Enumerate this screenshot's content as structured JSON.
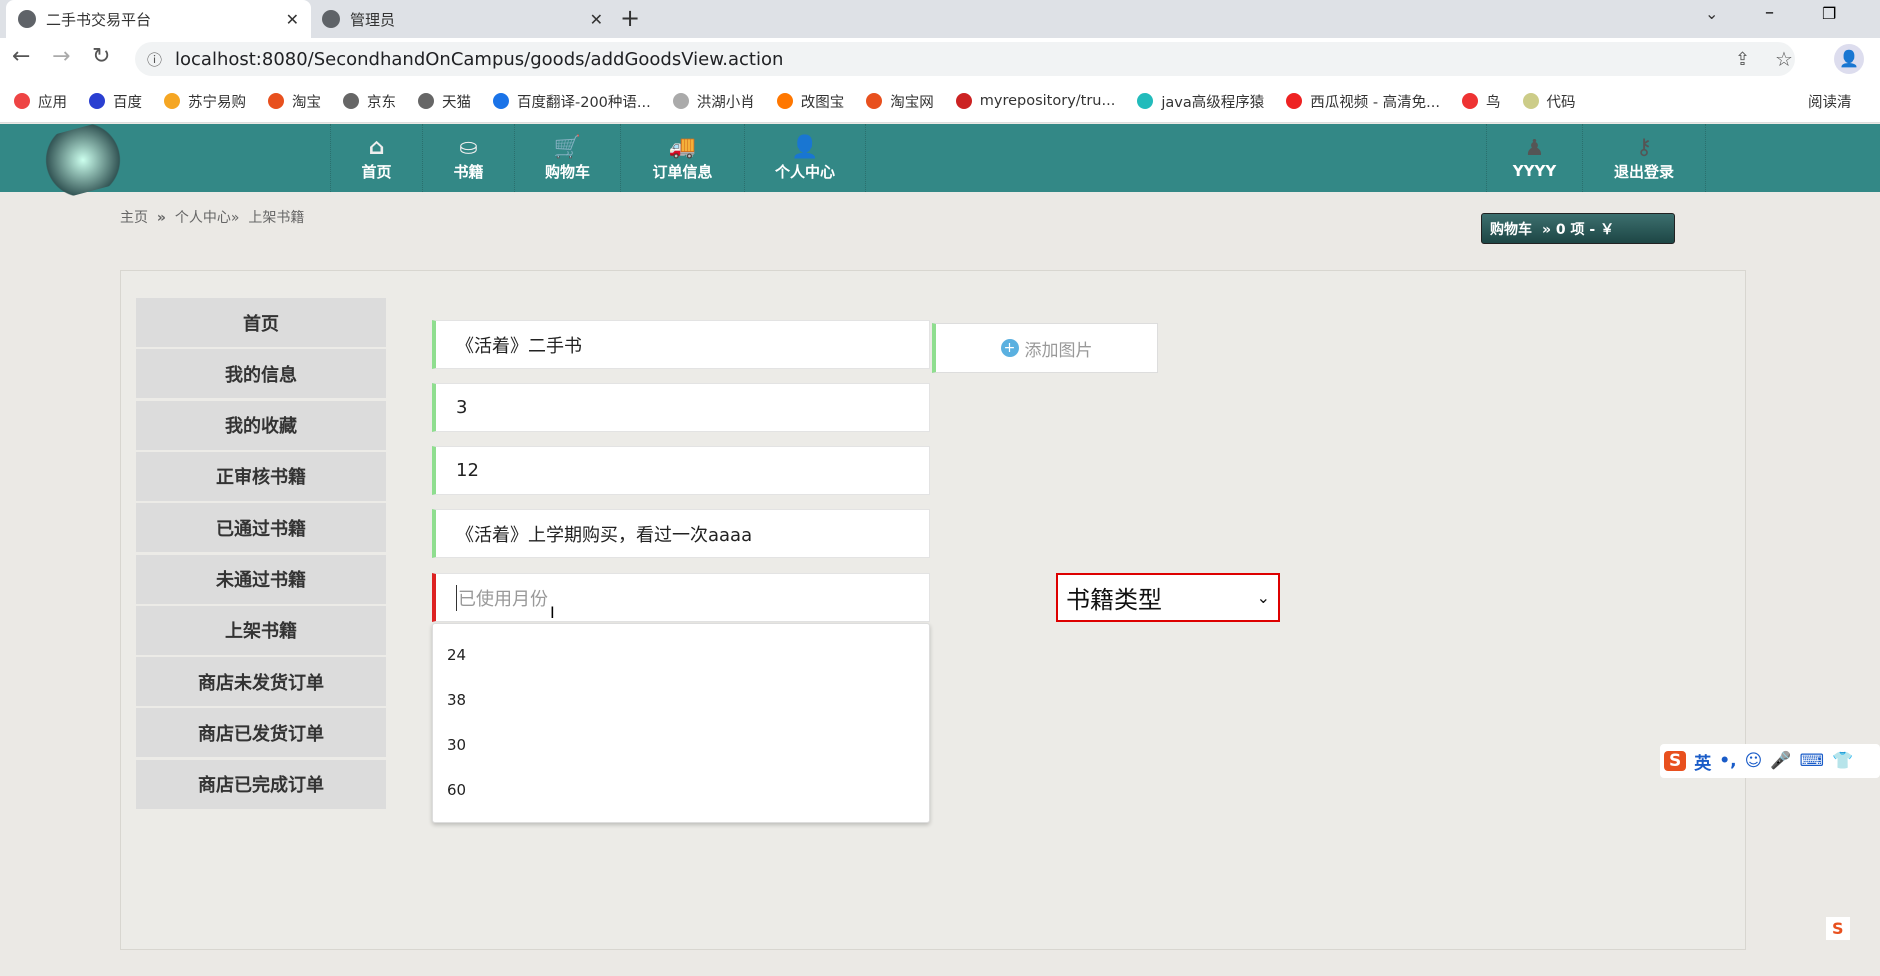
{
  "browser": {
    "tabs": [
      {
        "title": "二手书交易平台",
        "active": true
      },
      {
        "title": "管理员",
        "active": false
      }
    ],
    "url": "localhost:8080/SecondhandOnCampus/goods/addGoodsView.action",
    "bookmarks": [
      "应用",
      "百度",
      "苏宁易购",
      "淘宝",
      "京东",
      "天猫",
      "百度翻译-200种语...",
      "洪湖小肖",
      "改图宝",
      "淘宝网",
      "myrepository/tru...",
      "java高级程序猿",
      "西瓜视频 - 高清免...",
      "鸟",
      "代码"
    ],
    "reading_list": "阅读清"
  },
  "nav": {
    "items": [
      {
        "label": "首页",
        "icon": "home-icon"
      },
      {
        "label": "书籍",
        "icon": "basket-icon"
      },
      {
        "label": "购物车",
        "icon": "cart-icon"
      },
      {
        "label": "订单信息",
        "icon": "truck-icon"
      },
      {
        "label": "个人中心",
        "icon": "user-add-icon"
      }
    ],
    "user": "YYYY",
    "logout": "退出登录"
  },
  "breadcrumb": {
    "home": "主页",
    "sep": "»",
    "personal": "个人中心»",
    "current": "上架书籍"
  },
  "cart": {
    "label": "购物车",
    "summary": "» 0 项 - ￥"
  },
  "sidebar": [
    "首页",
    "我的信息",
    "我的收藏",
    "正审核书籍",
    "已通过书籍",
    "未通过书籍",
    "上架书籍",
    "商店未发货订单",
    "商店已发货订单",
    "商店已完成订单"
  ],
  "form": {
    "title": "《活着》二手书",
    "quantity": "3",
    "price": "12",
    "description": "《活着》上学期购买，看过一次aaaa",
    "months_placeholder": "已使用月份",
    "add_image": "添加图片",
    "category": "书籍类型",
    "suggestions": [
      "24",
      "38",
      "30",
      "60"
    ]
  },
  "ime": {
    "mode": "英"
  }
}
